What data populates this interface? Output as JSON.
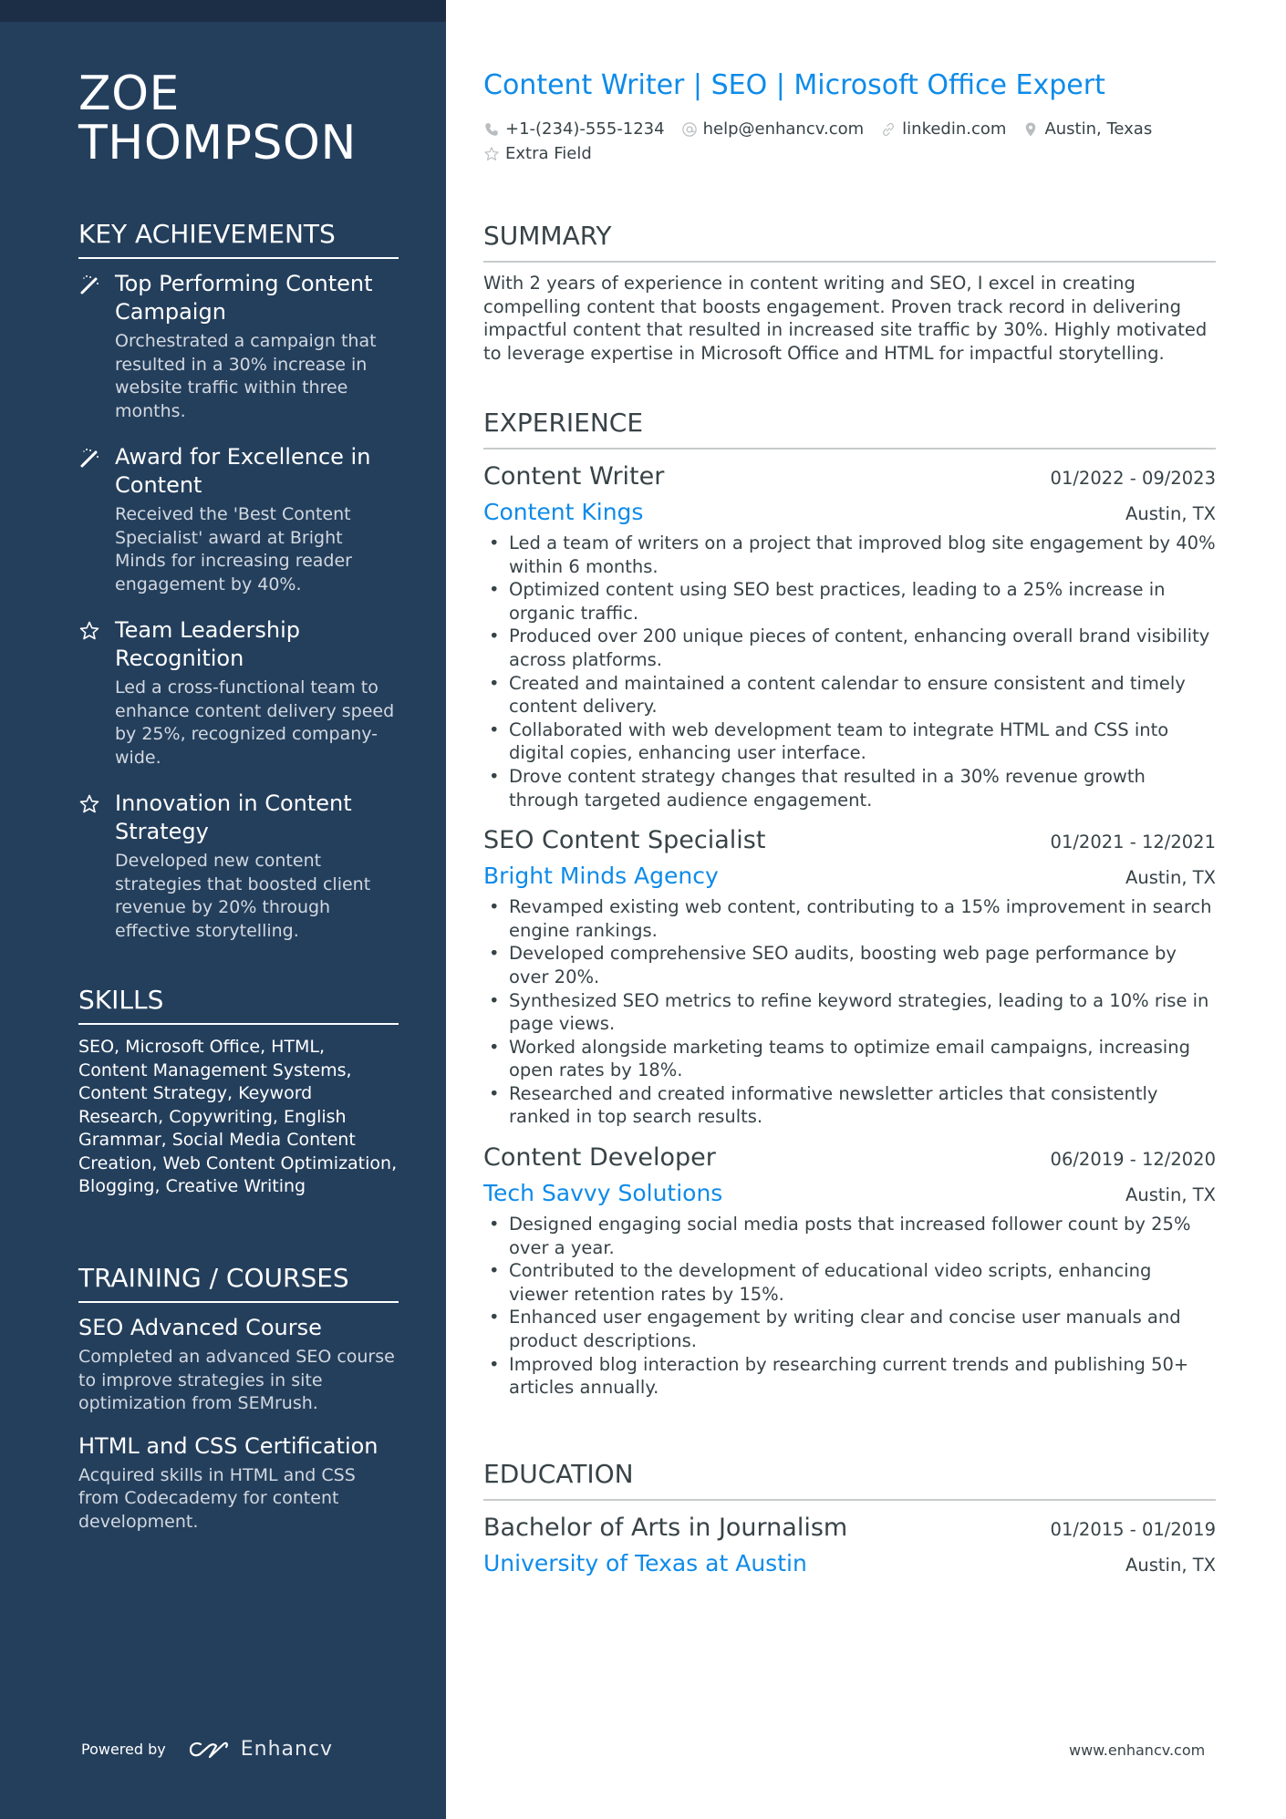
{
  "name": {
    "first": "ZOE",
    "last": "THOMPSON"
  },
  "headline": "Content Writer | SEO | Microsoft Office Expert",
  "contacts": [
    {
      "icon": "phone-icon",
      "text": "+1-(234)-555-1234"
    },
    {
      "icon": "at-icon",
      "text": "help@enhancv.com"
    },
    {
      "icon": "link-icon",
      "text": "linkedin.com"
    },
    {
      "icon": "location-pin-icon",
      "text": "Austin, Texas"
    },
    {
      "icon": "star-icon",
      "text": "Extra Field"
    }
  ],
  "sidebar": {
    "achievements": {
      "header": "KEY ACHIEVEMENTS",
      "items": [
        {
          "icon": "magic-wand-icon",
          "title": "Top Performing Content Campaign",
          "desc": "Orchestrated a campaign that resulted in a 30% increase in website traffic within three months."
        },
        {
          "icon": "magic-wand-icon",
          "title": "Award for Excellence in Content",
          "desc": "Received the 'Best Content Specialist' award at Bright Minds for increasing reader engagement by 40%."
        },
        {
          "icon": "star-icon",
          "title": "Team Leadership Recognition",
          "desc": "Led a cross-functional team to enhance content delivery speed by 25%, recognized company-wide."
        },
        {
          "icon": "star-icon",
          "title": "Innovation in Content Strategy",
          "desc": "Developed new content strategies that boosted client revenue by 20% through effective storytelling."
        }
      ]
    },
    "skills": {
      "header": "SKILLS",
      "text": "SEO, Microsoft Office, HTML, Content Management Systems, Content Strategy, Keyword Research, Copywriting, English Grammar, Social Media Content Creation, Web Content Optimization, Blogging, Creative Writing"
    },
    "training": {
      "header": "TRAINING / COURSES",
      "items": [
        {
          "title": "SEO Advanced Course",
          "desc": "Completed an advanced SEO course to improve strategies in site optimization from SEMrush."
        },
        {
          "title": "HTML and CSS Certification",
          "desc": "Acquired skills in HTML and CSS from Codecademy for content development."
        }
      ]
    },
    "powered_by": "Powered by",
    "brand": "Enhancv"
  },
  "summary": {
    "header": "SUMMARY",
    "text": "With 2 years of experience in content writing and SEO, I excel in creating compelling content that boosts engagement. Proven track record in delivering impactful content that resulted in increased site traffic by 30%. Highly motivated to leverage expertise in Microsoft Office and HTML for impactful storytelling."
  },
  "experience": {
    "header": "EXPERIENCE",
    "jobs": [
      {
        "title": "Content Writer",
        "dates": "01/2022 - 09/2023",
        "company": "Content Kings",
        "location": "Austin, TX",
        "bullets": [
          "Led a team of writers on a project that improved blog site engagement by 40% within 6 months.",
          "Optimized content using SEO best practices, leading to a 25% increase in organic traffic.",
          "Produced over 200 unique pieces of content, enhancing overall brand visibility across platforms.",
          "Created and maintained a content calendar to ensure consistent and timely content delivery.",
          "Collaborated with web development team to integrate HTML and CSS into digital copies, enhancing user interface.",
          "Drove content strategy changes that resulted in a 30% revenue growth through targeted audience engagement."
        ]
      },
      {
        "title": "SEO Content Specialist",
        "dates": "01/2021 - 12/2021",
        "company": "Bright Minds Agency",
        "location": "Austin, TX",
        "bullets": [
          "Revamped existing web content, contributing to a 15% improvement in search engine rankings.",
          "Developed comprehensive SEO audits, boosting web page performance by over 20%.",
          "Synthesized SEO metrics to refine keyword strategies, leading to a 10% rise in page views.",
          "Worked alongside marketing teams to optimize email campaigns, increasing open rates by 18%.",
          "Researched and created informative newsletter articles that consistently ranked in top search results."
        ]
      },
      {
        "title": "Content Developer",
        "dates": "06/2019 - 12/2020",
        "company": "Tech Savvy Solutions",
        "location": "Austin, TX",
        "bullets": [
          "Designed engaging social media posts that increased follower count by 25% over a year.",
          "Contributed to the development of educational video scripts, enhancing viewer retention rates by 15%.",
          "Enhanced user engagement by writing clear and concise user manuals and product descriptions.",
          "Improved blog interaction by researching current trends and publishing 50+ articles annually."
        ]
      }
    ]
  },
  "education": {
    "header": "EDUCATION",
    "degree": "Bachelor of Arts in Journalism",
    "dates": "01/2015 - 01/2019",
    "school": "University of Texas at Austin",
    "location": "Austin, TX"
  },
  "footer_url": "www.enhancv.com",
  "colors": {
    "sidebar": "#243f5c",
    "sidebar_top": "#1c2e45",
    "accent": "#0e8be9",
    "text": "#384347"
  }
}
